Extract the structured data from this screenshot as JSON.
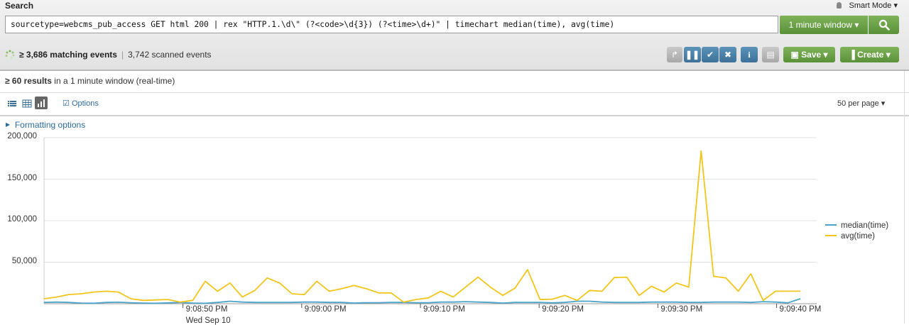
{
  "search": {
    "title": "Search",
    "mode": "Smart Mode",
    "query": "sourcetype=webcms_pub_access GET html 200 | rex \"HTTP.1.\\d\\\" (?<code>\\d{3}) (?<time>\\d+)\" | timechart median(time), avg(time)",
    "time_range": "1 minute window",
    "search_icon": "magnifier-icon"
  },
  "status": {
    "matching": "≥ 3,686 matching events",
    "divider": "|",
    "scanned": "3,742 scanned events"
  },
  "toolbar": {
    "save": "Save",
    "create": "Create",
    "icons": [
      "finalize-icon",
      "pause-icon",
      "check-icon",
      "cancel-icon",
      "info-icon",
      "print-icon"
    ]
  },
  "results": {
    "count": "≥ 60 results",
    "suffix": " in a 1 minute window (real-time)"
  },
  "view": {
    "options": "Options",
    "per_page": "50 per page"
  },
  "formatting": "Formatting options",
  "colors": {
    "median": "#4aa3c9",
    "avg": "#f2c51b",
    "accent": "#5a9139"
  },
  "chart_data": {
    "type": "line",
    "ylim": [
      0,
      200000
    ],
    "y_ticks": [
      "200,000",
      "150,000",
      "100,000",
      "50,000"
    ],
    "x_ticks": [
      "9:08:50 PM",
      "9:09:00 PM",
      "9:09:10 PM",
      "9:09:20 PM",
      "9:09:30 PM",
      "9:09:40 PM"
    ],
    "x_subtitle": "Wed Sep 10",
    "x_start_seconds": 38.3,
    "x_tick_seconds": [
      50,
      60,
      70,
      80,
      90,
      100
    ],
    "x_end_seconds": 102,
    "series": [
      {
        "name": "median(time)",
        "color": "#4aa3c9",
        "values": [
          1500,
          2000,
          1500,
          800,
          500,
          1500,
          1800,
          1200,
          800,
          500,
          1000,
          1500,
          800,
          500,
          1500,
          3000,
          2000,
          1500,
          1500,
          1500,
          1500,
          2000,
          2000,
          1500,
          1500,
          800,
          1200,
          1200,
          1500,
          1500,
          1200,
          1200,
          2000,
          2000,
          2500,
          2000,
          1500,
          800,
          1500,
          1500,
          1500,
          1000,
          1500,
          3000,
          3000,
          2000,
          1500,
          1500,
          1500,
          2000,
          2000,
          2000,
          1500,
          1500,
          2000,
          2000,
          2000,
          1500,
          2500,
          2000,
          1000,
          6000
        ]
      },
      {
        "name": "avg(time)",
        "color": "#f2c51b",
        "values": [
          6000,
          8000,
          11000,
          12000,
          14000,
          15000,
          14000,
          6000,
          4000,
          4500,
          5000,
          2000,
          4000,
          27000,
          15000,
          25000,
          8000,
          16000,
          31000,
          25000,
          12000,
          11000,
          27000,
          15000,
          18000,
          22000,
          18000,
          13000,
          13000,
          2000,
          5000,
          7000,
          15000,
          8000,
          20000,
          32000,
          20000,
          10000,
          19000,
          41000,
          5000,
          5500,
          10000,
          4000,
          16000,
          15000,
          31500,
          32000,
          10000,
          21000,
          14000,
          25000,
          20000,
          184000,
          33000,
          31000,
          15000,
          36000,
          4000,
          15000,
          15000,
          15000
        ]
      }
    ]
  }
}
